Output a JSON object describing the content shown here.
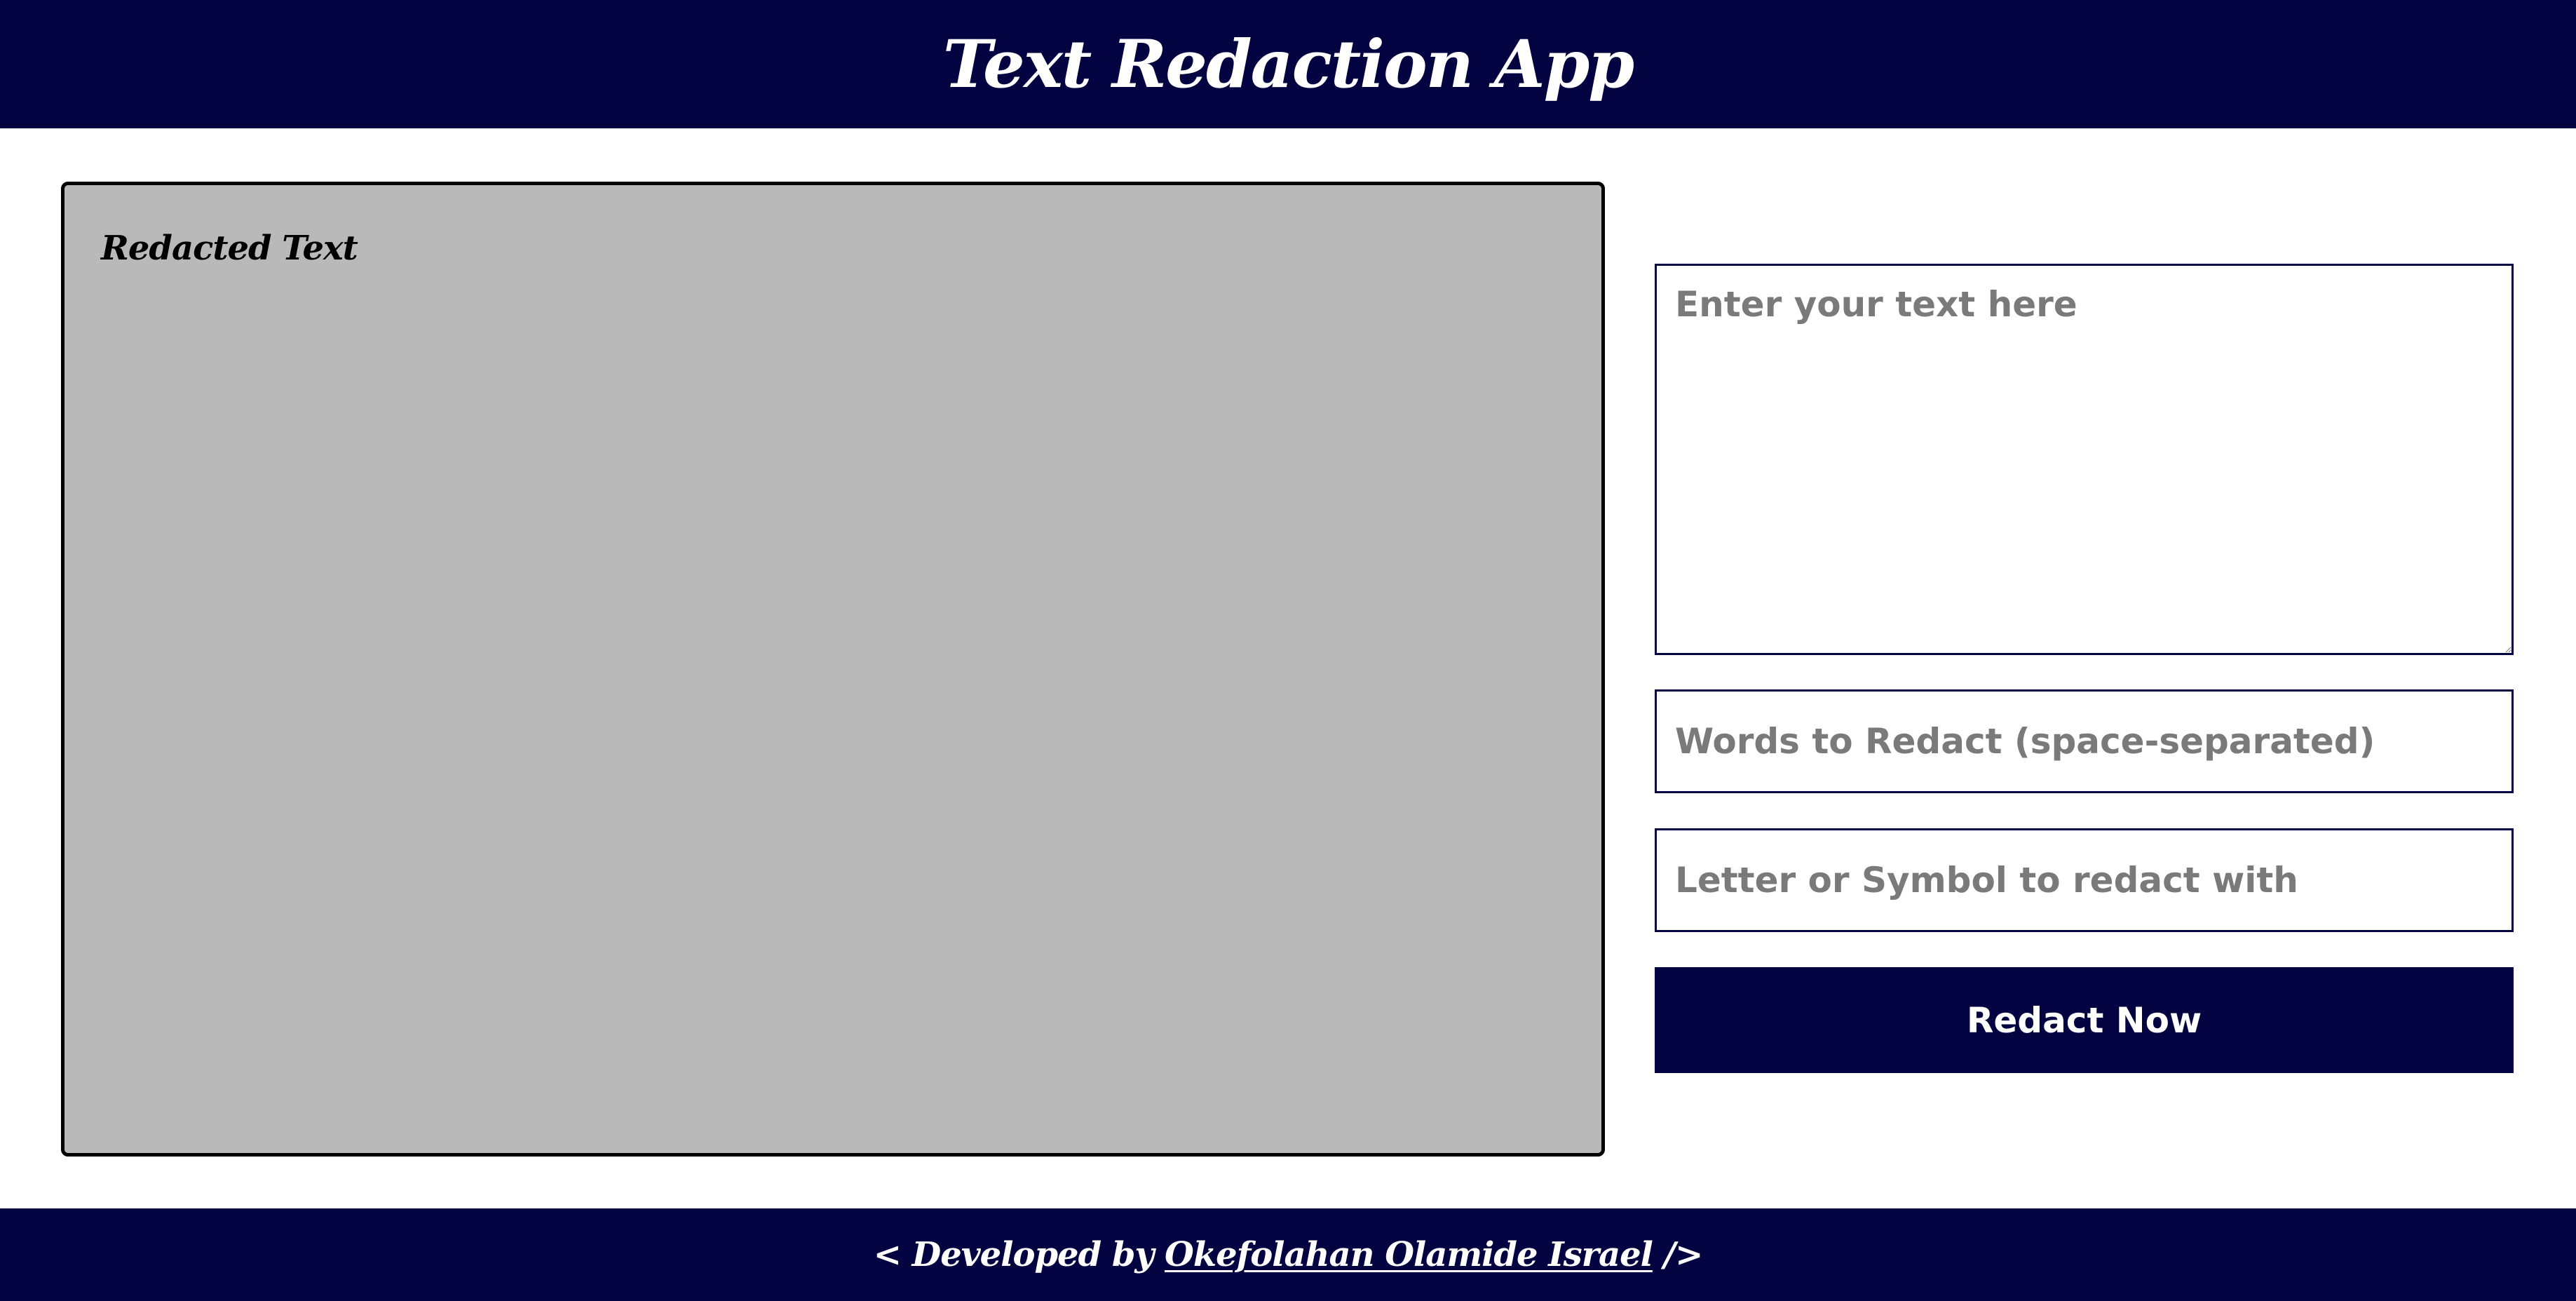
{
  "colors": {
    "navy": "#030342",
    "panel_gray": "#b9b9b9",
    "placeholder_gray": "#7a7a7a"
  },
  "header": {
    "title": "Text Redaction App"
  },
  "output": {
    "title": "Redacted Text",
    "content": ""
  },
  "form": {
    "text_input": {
      "placeholder": "Enter your text here",
      "value": ""
    },
    "words_input": {
      "placeholder": "Words to Redact (space-separated)",
      "value": ""
    },
    "symbol_input": {
      "placeholder": "Letter or Symbol to redact with",
      "value": ""
    },
    "submit_label": "Redact Now"
  },
  "footer": {
    "prefix": "< Developed by ",
    "author_link": "Okefolahan Olamide Israel",
    "suffix": " />"
  }
}
